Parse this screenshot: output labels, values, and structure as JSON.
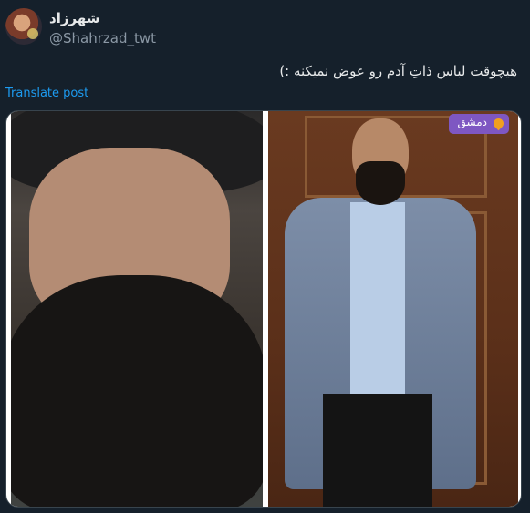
{
  "author": {
    "display_name": "شهرزاد",
    "handle": "@Shahrzad_twt",
    "avatar_icon": "profile-avatar"
  },
  "tweet": {
    "text": "هیچوقت لباس ذاتِ آدم رو عوض نمیکنه :)",
    "translate_label": "Translate post"
  },
  "media": {
    "location_badge": "دمشق"
  },
  "colors": {
    "background": "#15202b",
    "link": "#1d9bf0",
    "secondary_text": "#8b98a5",
    "badge": "#7e57c2"
  }
}
